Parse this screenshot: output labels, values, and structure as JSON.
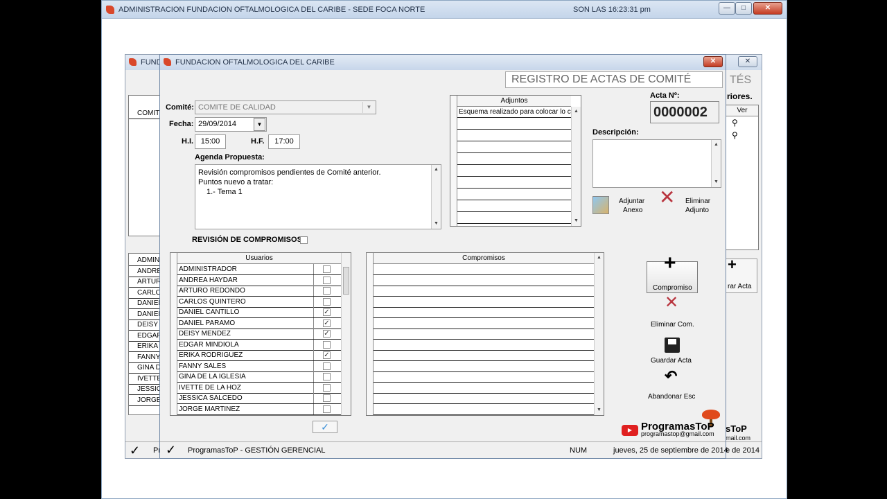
{
  "main_window": {
    "title": "ADMINISTRACION FUNDACION OFTALMOLOGICA DEL CARIBE - SEDE FOCA NORTE",
    "clock": "SON LAS 16:23:31 pm",
    "min_label": "—",
    "max_label": "□",
    "close_label": "✕"
  },
  "back_dialog": {
    "title": "FUND",
    "close_label": "✕",
    "header_frag": "TÉS",
    "anteriores_frag": "riores.",
    "ver_header": "Ver",
    "top_grid_first": "COMITE",
    "names": [
      "ADMINIS",
      "ANDREA",
      "ARTURO",
      "CARLO",
      "DANIEL",
      "DANIEL",
      "DEISY M",
      "EDGAR",
      "ERIKA R",
      "FANNY",
      "GINA DE",
      "IVETTE",
      "JESSICA",
      "JORGE"
    ],
    "btn_frag": "rar Acta",
    "brand_frag": "sToP",
    "email_frag": "mail.com",
    "status_left": "Pr",
    "status_date_frag": "e de 2014"
  },
  "dialog": {
    "title": "FUNDACION OFTALMOLOGICA DEL CARIBE",
    "close_label": "✕",
    "header": "REGISTRO DE ACTAS DE COMITÉ",
    "comite_label": "Comité:",
    "comite_value": "COMITE DE CALIDAD",
    "fecha_label": "Fecha:",
    "fecha_value": "29/09/2014",
    "hi_label": "H.I.",
    "hi_value": "15:00",
    "hf_label": "H.F.",
    "hf_value": "17:00",
    "agenda_label": "Agenda Propuesta:",
    "agenda_lines": [
      "Revisión compromisos pendientes de Comité anterior.",
      "Puntos nuevo a tratar:",
      "1.-  Tema 1"
    ],
    "revision_label": "REVISIÓN DE COMPROMISOS",
    "adjuntos_header": "Adjuntos",
    "adjuntos_first": "Esquema realizado para colocar lo c",
    "acta_label": "Acta Nº:",
    "acta_value": "0000002",
    "descripcion_label": "Descripción:",
    "adjuntar_label_1": "Adjuntar",
    "adjuntar_label_2": "Anexo",
    "eliminar_adj_label_1": "Eliminar",
    "eliminar_adj_label_2": "Adjunto",
    "usuarios_header": "Usuarios",
    "compromisos_header": "Compromisos",
    "usuarios": [
      {
        "name": "ADMINISTRADOR",
        "checked": false
      },
      {
        "name": "ANDREA HAYDAR",
        "checked": false
      },
      {
        "name": "ARTURO REDONDO",
        "checked": false
      },
      {
        "name": "CARLOS QUINTERO",
        "checked": false
      },
      {
        "name": "DANIEL CANTILLO",
        "checked": true
      },
      {
        "name": "DANIEL PARAMO",
        "checked": true
      },
      {
        "name": "DEISY MENDEZ",
        "checked": true
      },
      {
        "name": "EDGAR MINDIOLA",
        "checked": false
      },
      {
        "name": "ERIKA RODRIGUEZ",
        "checked": true
      },
      {
        "name": "FANNY SALES",
        "checked": false
      },
      {
        "name": "GINA DE LA IGLESIA",
        "checked": false
      },
      {
        "name": "IVETTE DE LA HOZ",
        "checked": false
      },
      {
        "name": "JESSICA SALCEDO",
        "checked": false
      },
      {
        "name": "JORGE MARTINEZ",
        "checked": false
      }
    ],
    "btn_compromiso": "Compromiso",
    "btn_eliminar_com": "Eliminar Com.",
    "btn_guardar": "Guardar Acta",
    "btn_abandonar": "Abandonar Esc",
    "brand_name": "ProgramasToP",
    "brand_email": "programastop@gmail.com",
    "status_app": "ProgramasToP - GESTIÓN GERENCIAL",
    "status_num": "NUM",
    "status_date": "jueves, 25 de septiembre de 2014"
  },
  "colors": {
    "accent_red": "#c0392b",
    "check": "#3a8fd8"
  }
}
